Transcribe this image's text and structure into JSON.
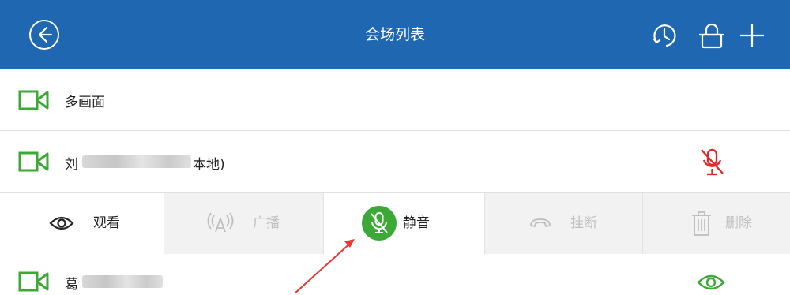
{
  "header": {
    "title": "会场列表",
    "background": "#1f67b1"
  },
  "rows": [
    {
      "name": "多画面",
      "icon": "video-camera-icon"
    },
    {
      "name_start": "刘",
      "name_end": "本地)",
      "status_icon": "mic-muted-icon",
      "status_color": "#e02a2a"
    },
    {
      "name_start": "葛",
      "status_icon": "eye-icon",
      "status_color": "#3ca836"
    }
  ],
  "actions": {
    "watch": "观看",
    "broadcast": "广播",
    "mute": "静音",
    "hangup": "挂断",
    "delete": "删除"
  },
  "colors": {
    "accent_green": "#3ca836",
    "muted_red": "#e02a2a",
    "disabled_text": "#c0c0c0"
  }
}
